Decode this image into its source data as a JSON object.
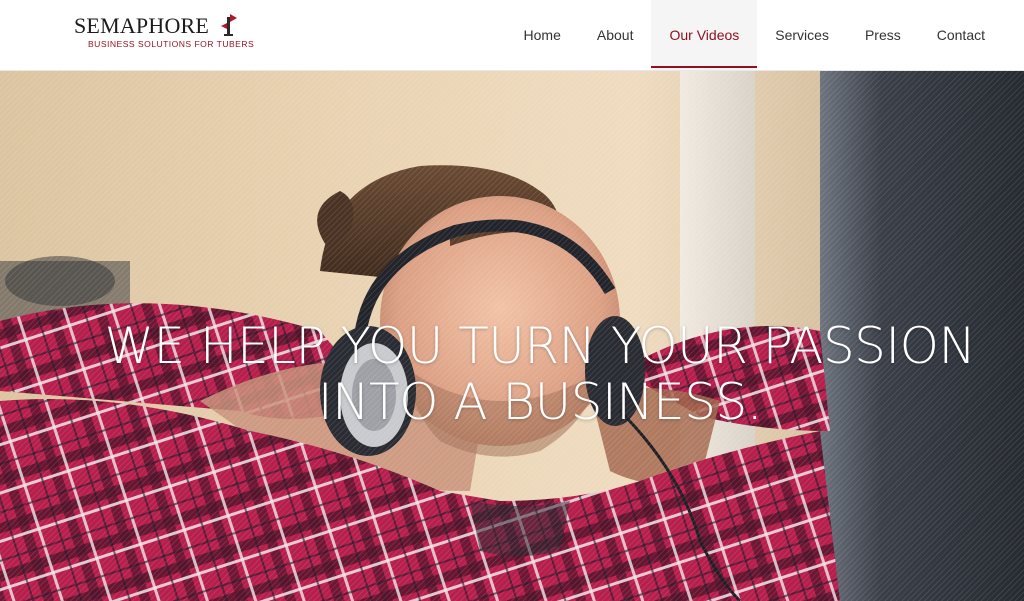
{
  "brand": {
    "name": "SEMAPHORE",
    "tagline": "BUSINESS SOLUTIONS FOR TUBERS",
    "accent_color": "#8e1120"
  },
  "nav": {
    "items": [
      {
        "label": "Home",
        "active": false
      },
      {
        "label": "About",
        "active": false
      },
      {
        "label": "Our Videos",
        "active": true
      },
      {
        "label": "Services",
        "active": false
      },
      {
        "label": "Press",
        "active": false
      },
      {
        "label": "Contact",
        "active": false
      }
    ]
  },
  "hero": {
    "headline_line1": "WE HELP YOU TURN YOUR PASSION",
    "headline_line2": "INTO A BUSINESS.",
    "image_subject": "man-with-headphones-relaxing-photo"
  }
}
